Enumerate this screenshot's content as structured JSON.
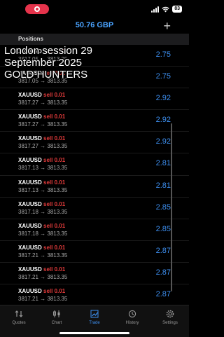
{
  "header": {
    "balance": "50.76 GBP",
    "add_label": "+"
  },
  "status": {
    "battery": "83"
  },
  "section": {
    "title": "Positions"
  },
  "overlay": {
    "line1": "London session 29",
    "line2": "September 2025",
    "line3": "GOLD HUNTERS"
  },
  "positions": [
    {
      "symbol": "XAUUSD",
      "side": "sell 0.01",
      "prices": "3817.05 → 3813.35",
      "pl": "2.75"
    },
    {
      "symbol": "XAUUSD",
      "side": "sell 0.01",
      "prices": "3817.05 → 3813.35",
      "pl": "2.75"
    },
    {
      "symbol": "XAUUSD",
      "side": "sell 0.01",
      "prices": "3817.27 → 3813.35",
      "pl": "2.92"
    },
    {
      "symbol": "XAUUSD",
      "side": "sell 0.01",
      "prices": "3817.27 → 3813.35",
      "pl": "2.92"
    },
    {
      "symbol": "XAUUSD",
      "side": "sell 0.01",
      "prices": "3817.27 → 3813.35",
      "pl": "2.92"
    },
    {
      "symbol": "XAUUSD",
      "side": "sell 0.01",
      "prices": "3817.13 → 3813.35",
      "pl": "2.81"
    },
    {
      "symbol": "XAUUSD",
      "side": "sell 0.01",
      "prices": "3817.13 → 3813.35",
      "pl": "2.81"
    },
    {
      "symbol": "XAUUSD",
      "side": "sell 0.01",
      "prices": "3817.18 → 3813.35",
      "pl": "2.85"
    },
    {
      "symbol": "XAUUSD",
      "side": "sell 0.01",
      "prices": "3817.18 → 3813.35",
      "pl": "2.85"
    },
    {
      "symbol": "XAUUSD",
      "side": "sell 0.01",
      "prices": "3817.21 → 3813.35",
      "pl": "2.87"
    },
    {
      "symbol": "XAUUSD",
      "side": "sell 0.01",
      "prices": "3817.21 → 3813.35",
      "pl": "2.87"
    },
    {
      "symbol": "XAUUSD",
      "side": "sell 0.01",
      "prices": "3817.21 → 3813.35",
      "pl": "2.87"
    }
  ],
  "tabs": [
    {
      "label": "Quotes",
      "icon": "quotes-icon"
    },
    {
      "label": "Chart",
      "icon": "chart-icon"
    },
    {
      "label": "Trade",
      "icon": "trade-icon",
      "active": true
    },
    {
      "label": "History",
      "icon": "history-icon"
    },
    {
      "label": "Settings",
      "icon": "settings-icon"
    }
  ],
  "colors": {
    "accent": "#3d8ff0",
    "sell": "#e23b3b",
    "record": "#e5334b"
  }
}
